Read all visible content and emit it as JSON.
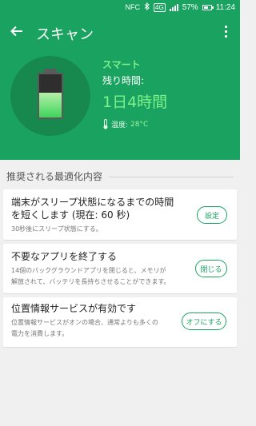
{
  "status_bar": {
    "nfc": "NFC",
    "network": "4G",
    "battery_percent": "57%",
    "time": "11:24"
  },
  "app_bar": {
    "title": "スキャン",
    "back_icon": "back-arrow-icon",
    "menu_icon": "more-vert-icon"
  },
  "battery": {
    "level": 0.57,
    "mode": "スマート",
    "remaining_label": "残り時間:",
    "remaining_value": "1日4時間",
    "temperature_label": "温度:",
    "temperature_value": "28°C"
  },
  "section": {
    "title": "推奨される最適化内容"
  },
  "cards": [
    {
      "title_line1": "端末がスリープ状態になるまでの時間",
      "title_line2": "を短くします (現在: 60 秒)",
      "desc_line1": "30秒後にスリープ状態にする。",
      "button": "設定"
    },
    {
      "title_line1": "不要なアプリを終了する",
      "desc_line1": "14個のバックグラウンドアプリを閉じると、メモリが",
      "desc_line2": "解放されて、バッテリを長持ちさせることができます。",
      "button": "閉じる"
    },
    {
      "title_line1": "位置情報サービスが有効です",
      "desc_line1": "位置情報サービスがオンの場合、通常よりも多くの",
      "desc_line2": "電力を消費します。",
      "button": "オフにする"
    }
  ],
  "colors": {
    "accent": "#1aa260",
    "accent_light": "#7df18a",
    "battery_fill": "#3ed45a"
  }
}
